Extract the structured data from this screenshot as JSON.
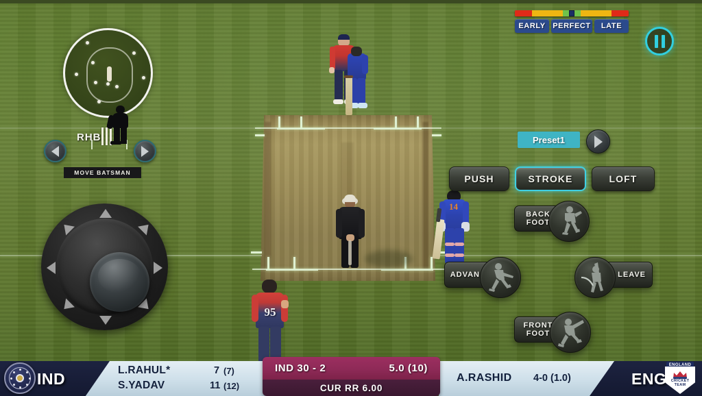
{
  "hud": {
    "timing_meter": {
      "labels": [
        "EARLY",
        "PERFECT",
        "LATE"
      ],
      "marker_position_pct": 50,
      "colors": {
        "early": "#e02a18",
        "mid": "#efb612",
        "perfect": "#6fc24a",
        "marker": "#1b2f66"
      }
    },
    "pause_button_label": "pause-icon",
    "preset": {
      "name": "Preset1",
      "next_label": "next-preset-arrow",
      "accent": "#3fb4c4"
    },
    "shot_types": [
      {
        "label": "PUSH",
        "active": false
      },
      {
        "label": "STROKE",
        "active": true
      },
      {
        "label": "LOFT",
        "active": false
      }
    ],
    "footwork": [
      {
        "label": "BACK FOOT",
        "line1": "BACK",
        "line2": "FOOT",
        "icon": "back-foot-batsman-icon"
      },
      {
        "label": "ADVANCE",
        "line1": "ADVANCE",
        "line2": "",
        "icon": "advance-batsman-icon"
      },
      {
        "label": "LEAVE",
        "line1": "LEAVE",
        "line2": "",
        "icon": "leave-ball-batsman-icon"
      },
      {
        "label": "FRONT FOOT",
        "line1": "FRONT",
        "line2": "FOOT",
        "icon": "front-foot-batsman-icon"
      }
    ],
    "move_batsman": {
      "stance": "RHB",
      "caption": "MOVE BATSMAN",
      "left_label": "move-left-arrow",
      "right_label": "move-right-arrow"
    },
    "joystick_label": "movement-joystick",
    "field_radar_label": "fielding-radar"
  },
  "scoreboard": {
    "batting_team": {
      "code": "IND",
      "emblem": "bcci-emblem"
    },
    "bowling_team": {
      "code": "ENG",
      "emblem": "england-cricket-badge",
      "badge_top_text": "ENGLAND",
      "badge_line1": "CRICKET",
      "badge_line2": "TEAM"
    },
    "batsmen": [
      {
        "name": "L.RAHUL*",
        "runs": "7",
        "balls": "(7)"
      },
      {
        "name": "S.YADAV",
        "runs": "11",
        "balls": "(12)"
      }
    ],
    "bowler": {
      "name": "A.RASHID",
      "figures": "4-0 (1.0)"
    },
    "team_score": "IND  30 - 2",
    "overs": "5.0 (10)",
    "run_rate": "CUR RR 6.00"
  },
  "players": {
    "striker_number": "14",
    "bowler_number": "95",
    "umpire_label": "umpire",
    "keeper_label": "wicket-keeper",
    "non_striker_label": "non-striker-batsman"
  }
}
